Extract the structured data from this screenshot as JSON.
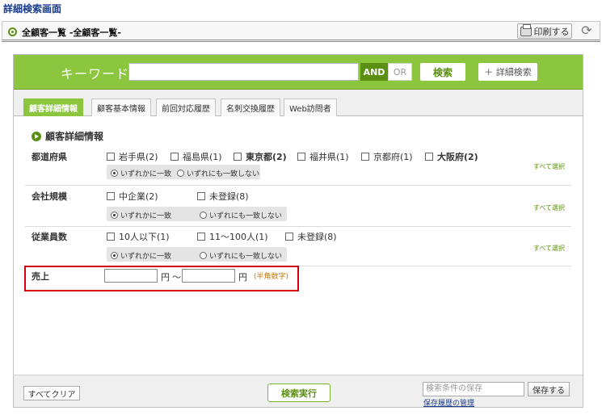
{
  "page_title": "詳細検索画面",
  "header": {
    "breadcrumb": "全顧客一覧 -全顧客一覧-",
    "print_label": "印刷する"
  },
  "keyword_bar": {
    "label": "キーワード",
    "input_value": "",
    "and_label": "AND",
    "or_label": "OR",
    "search_label": "検索",
    "advanced_label": "＋ 詳細検索"
  },
  "tabs": [
    {
      "label": "顧客詳細情報",
      "active": true
    },
    {
      "label": "顧客基本情報",
      "active": false
    },
    {
      "label": "前回対応履歴",
      "active": false
    },
    {
      "label": "名刺交換履歴",
      "active": false
    },
    {
      "label": "Web訪問者",
      "active": false
    }
  ],
  "section_title": "顧客詳細情報",
  "select_all_label": "すべて選択",
  "match_any": "いずれかに一致",
  "match_none": "いずれにも一致しない",
  "rows": {
    "prefecture": {
      "label": "都道府県",
      "options": [
        "岩手県(2)",
        "福島県(1)",
        "東京都(2)",
        "福井県(1)",
        "京都府(1)",
        "大阪府(2)"
      ]
    },
    "company_size": {
      "label": "会社規模",
      "options": [
        "中企業(2)",
        "未登録(8)"
      ]
    },
    "employees": {
      "label": "従業員数",
      "options": [
        "10人以下(1)",
        "11〜100人(1)",
        "未登録(8)"
      ]
    },
    "sales": {
      "label": "売上",
      "unit": "円",
      "tilde": "〜",
      "note": "(半角数字)",
      "from_value": "",
      "to_value": ""
    }
  },
  "footer": {
    "clear_label": "すべてクリア",
    "execute_label": "検索実行",
    "save_placeholder": "検索条件の保存",
    "save_label": "保存する",
    "history_link": "保存履歴の管理"
  }
}
